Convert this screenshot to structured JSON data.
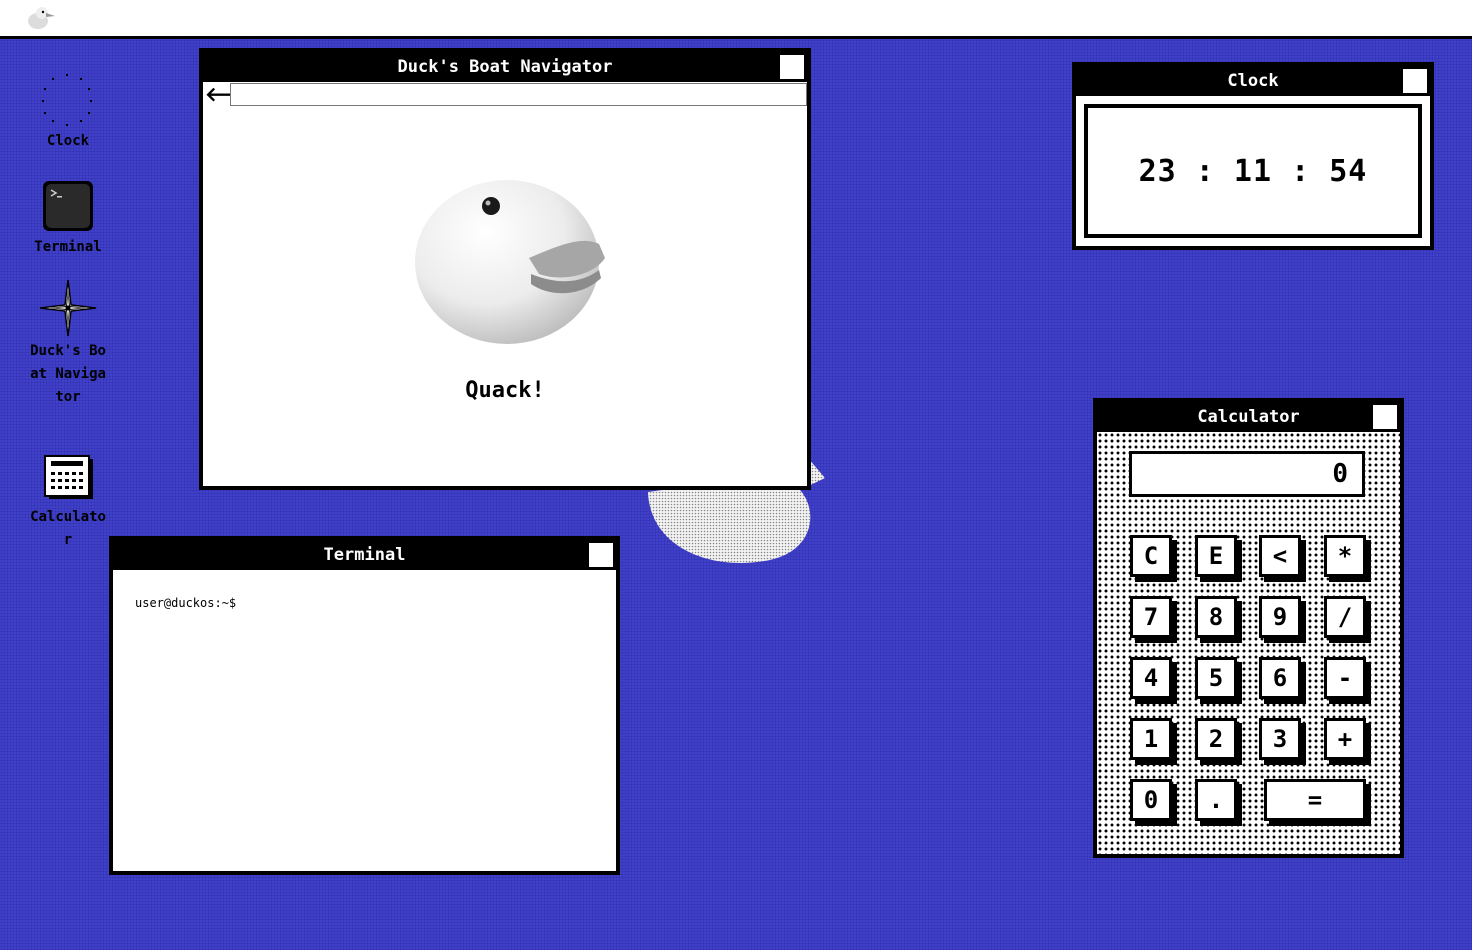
{
  "desktop_icons": [
    {
      "label": "Clock",
      "icon": "clock-icon"
    },
    {
      "label": "Terminal",
      "icon": "terminal-icon"
    },
    {
      "label": "Duck's Boat Navigator",
      "icon": "compass-icon"
    },
    {
      "label": "Calculator",
      "icon": "calculator-icon"
    }
  ],
  "navigator": {
    "title": "Duck's Boat Navigator",
    "back_glyph": "🡐",
    "url": "",
    "message": "Quack!"
  },
  "clock": {
    "title": "Clock",
    "time": "23 : 11 : 54"
  },
  "terminal": {
    "title": "Terminal",
    "prompt": "user@duckos:~$"
  },
  "calculator": {
    "title": "Calculator",
    "display": "0",
    "rows": [
      [
        "C",
        "E",
        "<",
        "*"
      ],
      [
        "7",
        "8",
        "9",
        "/"
      ],
      [
        "4",
        "5",
        "6",
        "-"
      ],
      [
        "1",
        "2",
        "3",
        "+"
      ],
      [
        "0",
        ".",
        "="
      ]
    ]
  },
  "colors": {
    "desktop": "#4040c8",
    "window_title": "#000000",
    "window_body": "#ffffff"
  }
}
